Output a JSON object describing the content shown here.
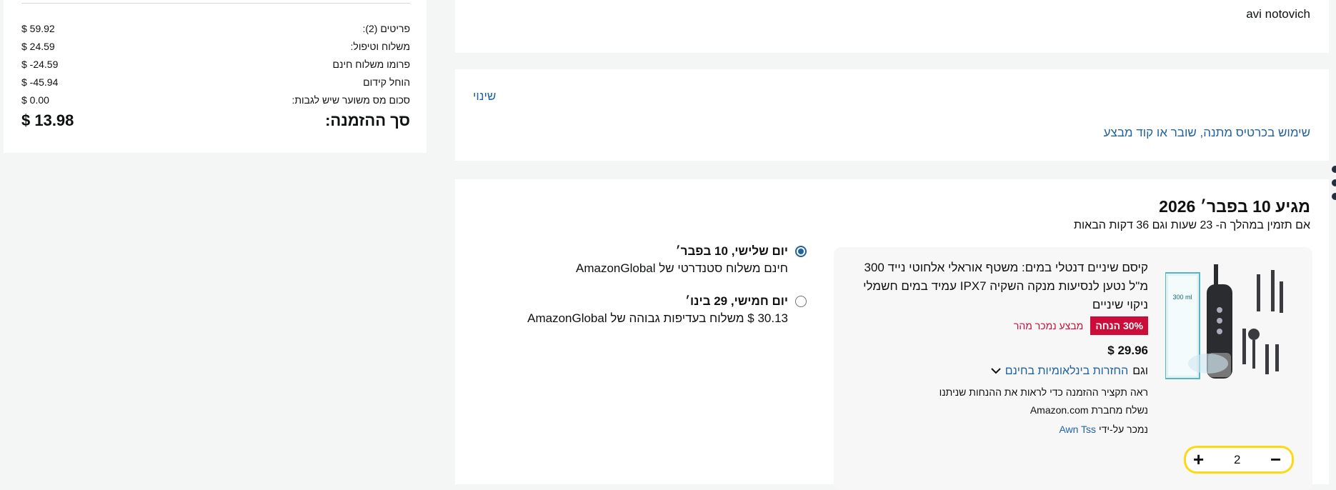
{
  "summary": {
    "rows": [
      {
        "label": "פריטים (2):",
        "value": "$ 59.92"
      },
      {
        "label": "משלוח וטיפול:",
        "value": "$ 24.59"
      },
      {
        "label": "פרומו משלוח חינם",
        "value": "$ -24.59"
      },
      {
        "label": "הוחל קידום",
        "value": "$ -45.94"
      },
      {
        "label": "סכום מס משוער שיש לגבות:",
        "value": "$ 0.00"
      }
    ],
    "total_label": "סך ההזמנה:",
    "total_value": "$ 13.98"
  },
  "address": {
    "name": "avi notovich"
  },
  "payment": {
    "change_link": "שינוי",
    "gift_link": "שימוש בכרטיס מתנה, שובר או קוד מבצע"
  },
  "delivery": {
    "arrival": "מגיע 10 בפבר׳ 2026",
    "cutoff": "אם תזמין במהלך ה-  23 שעות וגם 36 דקות הבאות",
    "product": {
      "title": "קיסם שיניים דנטלי במים: משטף אוראלי אלחוטי נייד 300 מ\"ל נטען לנסיעות מנקה השקיה IPX7 עמיד במים חשמלי ניקוי שיניים",
      "discount": "30% הנחה",
      "deal": "מבצע נמכר מהר",
      "price": "$ 29.96",
      "returns_prefix": "וגם",
      "returns_link": "החזרות בינלאומיות בחינם",
      "note": "ראה תקציר ההזמנה כדי לראות את ההנחות שניתנו",
      "shipped_by": "נשלח מחברת Amazon.com",
      "sold_by_prefix": "נמכר על-ידי",
      "seller": "Awn Tss",
      "quantity": "2",
      "image_box_text": "300 ml"
    },
    "options": [
      {
        "date": "יום שלישי, 10 בפבר׳",
        "desc": "חינם משלוח סטנדרטי של AmazonGlobal",
        "selected": true
      },
      {
        "date": "יום חמישי, 29 בינו׳",
        "desc": "30.13 $ משלוח בעדיפות גבוהה של AmazonGlobal",
        "selected": false
      }
    ]
  },
  "colors": {
    "link": "#2162a1",
    "discount": "#cc0c39",
    "stepper_border": "#ffd814"
  }
}
